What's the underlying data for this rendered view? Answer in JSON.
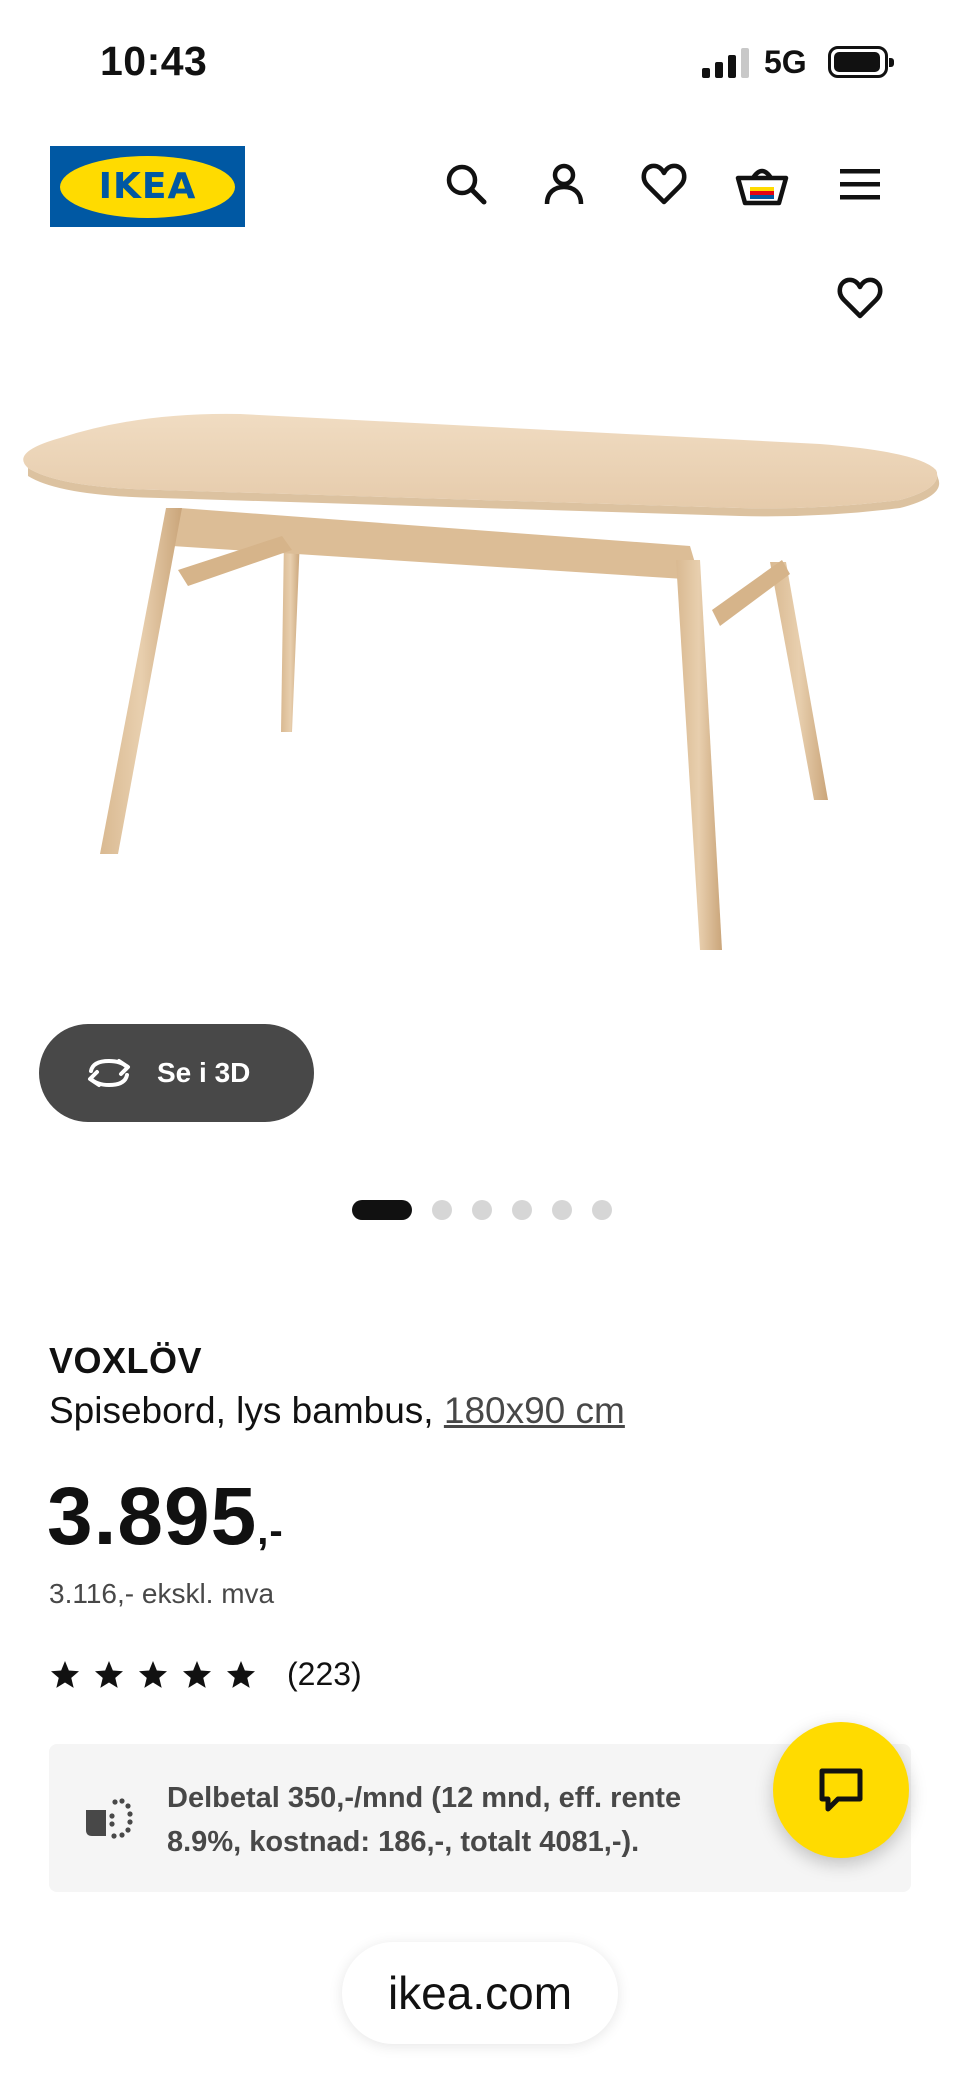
{
  "status_bar": {
    "time": "10:43",
    "network": "5G",
    "signal_bars_filled": 3,
    "signal_bars_total": 4,
    "battery_level": 0.85
  },
  "header": {
    "logo_text": "IKEA",
    "brand_colors": {
      "blue": "#0058a3",
      "yellow": "#ffdb00"
    },
    "icons": [
      "search-icon",
      "account-icon",
      "heart-icon",
      "basket-icon",
      "menu-icon"
    ]
  },
  "product": {
    "favorite_icon": "heart-icon",
    "view_3d_label": "Se i 3D",
    "gallery": {
      "total_images": 6,
      "active_index": 0
    },
    "name": "VOXLÖV",
    "description": "Spisebord, lys bambus,",
    "size": "180x90 cm",
    "price": "3.895",
    "price_suffix": ",-",
    "price_ex_vat": "3.116,- ekskl. mva",
    "rating": {
      "stars": 5,
      "max": 5,
      "count": "(223)"
    }
  },
  "installment": {
    "text": "Delbetal 350,-/mnd (12 mnd, eff. rente 8.9%, kostnad: 186,-, totalt 4081,-)."
  },
  "chat": {
    "icon": "chat-bubble-icon",
    "color": "#ffdb00"
  },
  "browser": {
    "url": "ikea.com"
  }
}
